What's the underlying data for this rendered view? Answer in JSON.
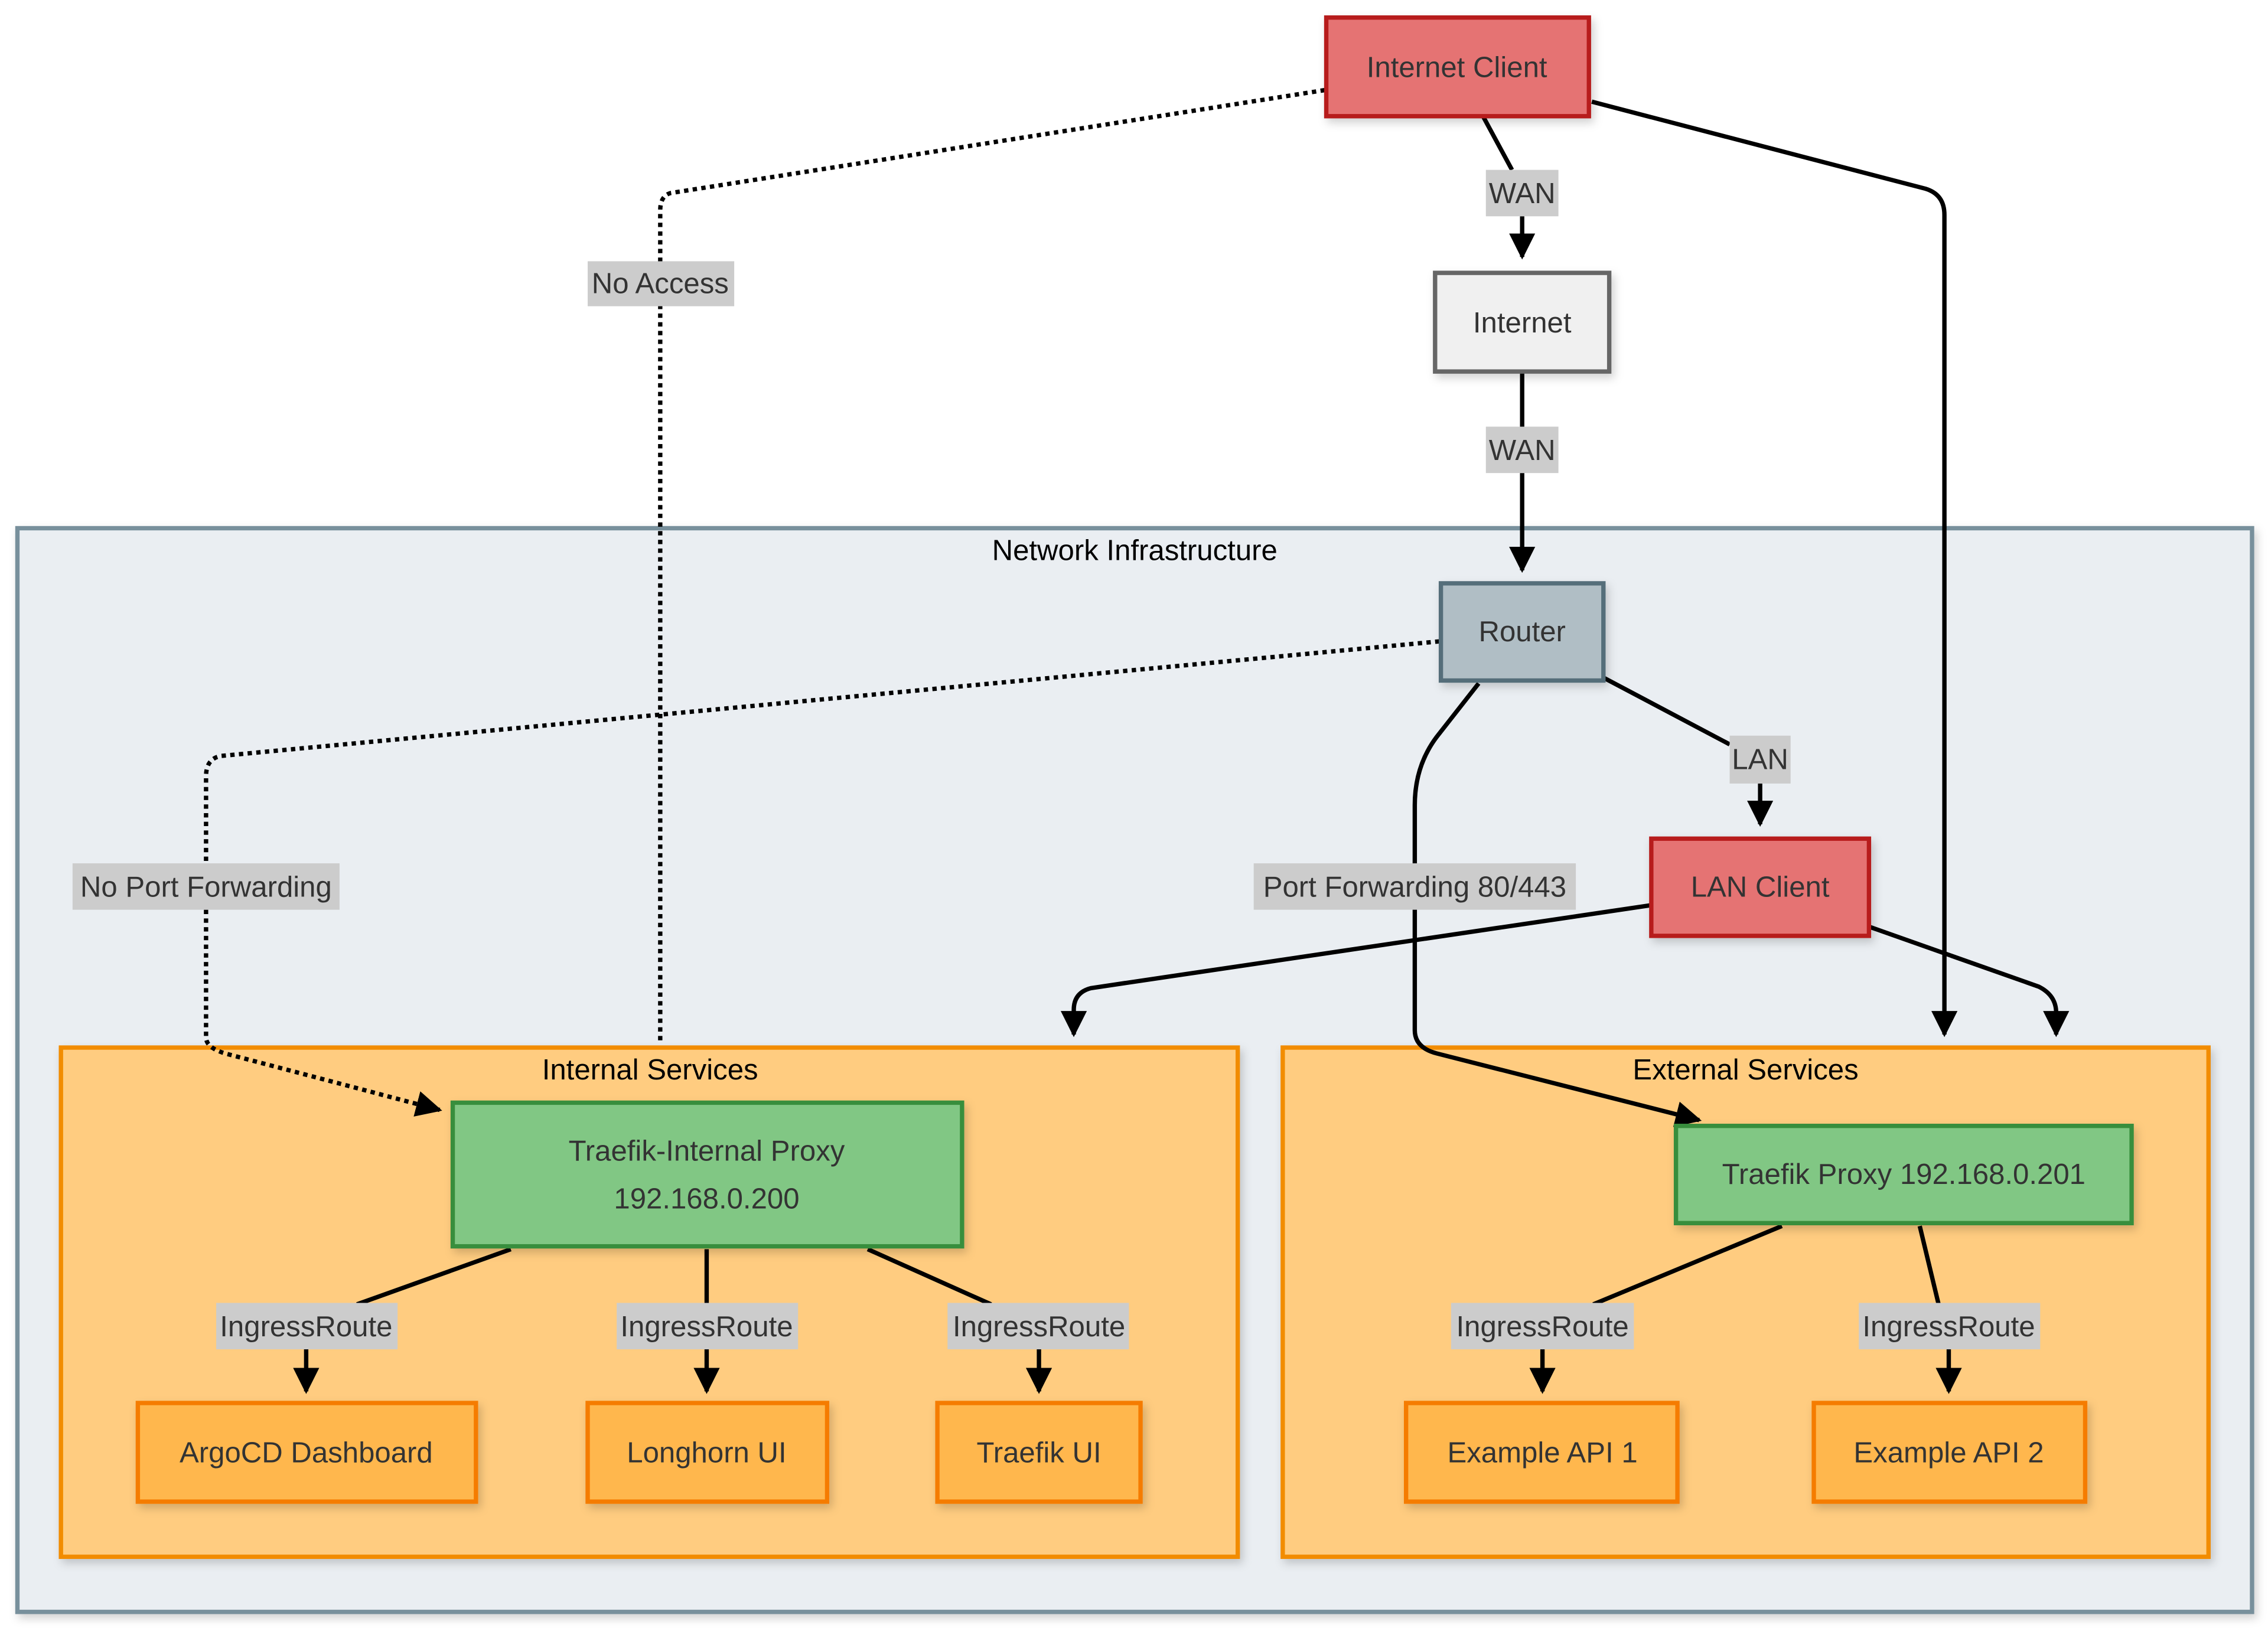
{
  "diagram": {
    "clusters": {
      "network": {
        "title": "Network Infrastructure",
        "fill": "#eaeef2",
        "stroke": "#78909c"
      },
      "internal": {
        "title": "Internal Services",
        "fill": "#ffcc80",
        "stroke": "#f28c00"
      },
      "external": {
        "title": "External Services",
        "fill": "#ffcc80",
        "stroke": "#f28c00"
      }
    },
    "nodes": {
      "internet_client": {
        "label": "Internet Client",
        "fill": "#e57373",
        "stroke": "#b71c1c"
      },
      "internet": {
        "label": "Internet",
        "fill": "#f0f0f0",
        "stroke": "#666666"
      },
      "router": {
        "label": "Router",
        "fill": "#b0bec5",
        "stroke": "#546e7a"
      },
      "lan_client": {
        "label": "LAN Client",
        "fill": "#e57373",
        "stroke": "#b71c1c"
      },
      "traefik_internal": {
        "label_line1": "Traefik-Internal Proxy",
        "label_line2": "192.168.0.200",
        "fill": "#81c784",
        "stroke": "#388e3c"
      },
      "traefik_external": {
        "label": "Traefik Proxy 192.168.0.201",
        "fill": "#81c784",
        "stroke": "#388e3c"
      },
      "argocd": {
        "label": "ArgoCD Dashboard",
        "fill": "#ffb74d",
        "stroke": "#f57c00"
      },
      "longhorn": {
        "label": "Longhorn UI",
        "fill": "#ffb74d",
        "stroke": "#f57c00"
      },
      "traefik_ui": {
        "label": "Traefik UI",
        "fill": "#ffb74d",
        "stroke": "#f57c00"
      },
      "api1": {
        "label": "Example API 1",
        "fill": "#ffb74d",
        "stroke": "#f57c00"
      },
      "api2": {
        "label": "Example API 2",
        "fill": "#ffb74d",
        "stroke": "#f57c00"
      }
    },
    "edge_labels": {
      "client_internet": "WAN",
      "internet_router": "WAN",
      "no_access": "No Access",
      "router_lan": "LAN",
      "no_port_forwarding": "No Port Forwarding",
      "port_forwarding": "Port Forwarding 80/443",
      "ingress_argocd": "IngressRoute",
      "ingress_longhorn": "IngressRoute",
      "ingress_traefik_ui": "IngressRoute",
      "ingress_api1": "IngressRoute",
      "ingress_api2": "IngressRoute"
    },
    "edge_label_bg": "#cccccc"
  }
}
